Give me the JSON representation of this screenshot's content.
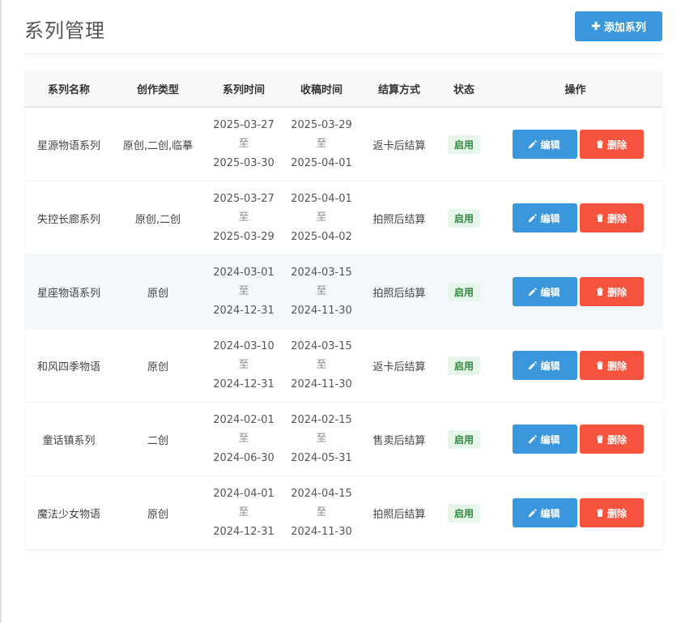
{
  "header": {
    "title": "系列管理",
    "add_button_label": "添加系列"
  },
  "table": {
    "columns": [
      "系列名称",
      "创作类型",
      "系列时间",
      "收稿时间",
      "结算方式",
      "状态",
      "操作"
    ],
    "rows": [
      {
        "name": "星源物语系列",
        "type": "原创,二创,临摹",
        "series_start": "2025-03-27",
        "series_end": "2025-03-30",
        "submit_start": "2025-03-29",
        "submit_end": "2025-04-01",
        "settlement": "返卡后结算",
        "status": "启用"
      },
      {
        "name": "失控长廊系列",
        "type": "原创,二创",
        "series_start": "2025-03-27",
        "series_end": "2025-03-29",
        "submit_start": "2025-04-01",
        "submit_end": "2025-04-02",
        "settlement": "拍照后结算",
        "status": "启用"
      },
      {
        "name": "星座物语系列",
        "type": "原创",
        "series_start": "2024-03-01",
        "series_end": "2024-12-31",
        "submit_start": "2024-03-15",
        "submit_end": "2024-11-30",
        "settlement": "拍照后结算",
        "status": "启用"
      },
      {
        "name": "和风四季物语",
        "type": "原创",
        "series_start": "2024-03-10",
        "series_end": "2024-12-31",
        "submit_start": "2024-03-15",
        "submit_end": "2024-11-30",
        "settlement": "返卡后结算",
        "status": "启用"
      },
      {
        "name": "童话镇系列",
        "type": "二创",
        "series_start": "2024-02-01",
        "series_end": "2024-06-30",
        "submit_start": "2024-02-15",
        "submit_end": "2024-05-31",
        "settlement": "售卖后结算",
        "status": "启用"
      },
      {
        "name": "魔法少女物语",
        "type": "原创",
        "series_start": "2024-04-01",
        "series_end": "2024-12-31",
        "submit_start": "2024-04-15",
        "submit_end": "2024-11-30",
        "settlement": "拍照后结算",
        "status": "启用"
      }
    ],
    "range_separator": "至",
    "edit_label": "编辑",
    "delete_label": "删除"
  },
  "colors": {
    "primary": "#3b97dc",
    "danger": "#f5533d",
    "status_bg": "#e6f5ea",
    "status_text": "#2f8a3e"
  },
  "icons": {
    "add": "plus-icon",
    "edit": "pencil-icon",
    "delete": "trash-icon"
  }
}
